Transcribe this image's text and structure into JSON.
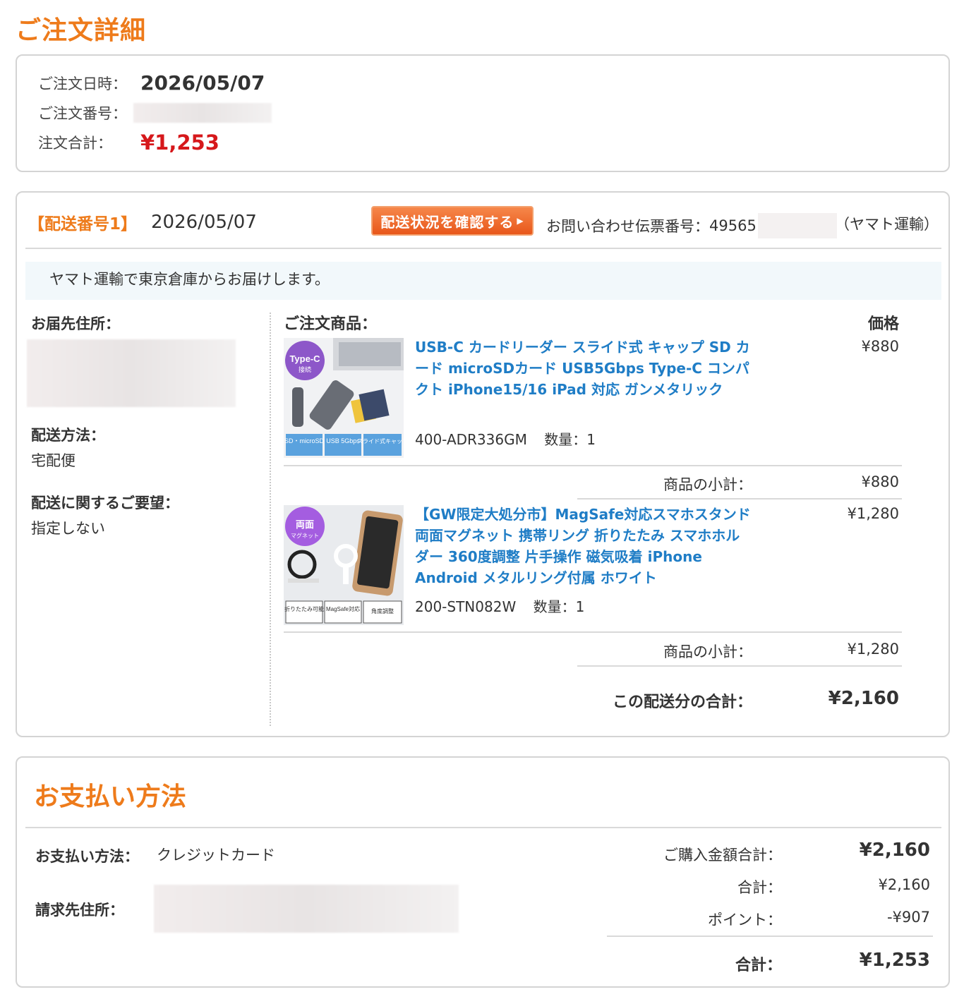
{
  "page_title": "ご注文詳細",
  "summary": {
    "date_label": "ご注文日時：",
    "date_value": "2026/05/07",
    "order_no_label": "ご注文番号：",
    "total_label": "注文合計：",
    "total_value": "¥1,253"
  },
  "shipment": {
    "number_label": "【配送番号1】",
    "date": "2026/05/07",
    "track_button": "配送状況を確認する",
    "inquiry_label": "お問い合わせ伝票番号：",
    "inquiry_number_prefix": "49565",
    "carrier": "（ヤマト運輸）",
    "notice": "ヤマト運輸で東京倉庫からお届けします。",
    "address_label": "お届先住所：",
    "method_label": "配送方法：",
    "method_value": "宅配便",
    "request_label": "配送に関するご要望：",
    "request_value": "指定しない",
    "items_header": "ご注文商品：",
    "price_header": "価格",
    "items": [
      {
        "name": "USB-C カードリーダー スライド式 キャップ SD カード microSDカード USB5Gbps Type-C コンパクト iPhone15/16 iPad 対応 ガンメタリック",
        "sku": "400-ADR336GM",
        "qty": "数量：1",
        "price": "¥880",
        "subtotal_label": "商品の小計：",
        "subtotal": "¥880",
        "thumb_badge": "Type-C",
        "thumb_badge_sub": "接続",
        "thumb_tags": [
          "SD・microSD",
          "USB 5Gbps",
          "スライド式キャップ"
        ]
      },
      {
        "name": "【GW限定大処分市】MagSafe対応スマホスタンド 両面マグネット 携帯リング 折りたたみ スマホホルダー 360度調整 片手操作 磁気吸着 iPhone Android メタルリング付属 ホワイト",
        "sku": "200-STN082W",
        "qty": "数量：1",
        "price": "¥1,280",
        "subtotal_label": "商品の小計：",
        "subtotal": "¥1,280",
        "thumb_badge": "両面",
        "thumb_badge_sub": "マグネット",
        "thumb_tags": [
          "折りたたみ可能",
          "MagSafe対応",
          "角度調整"
        ]
      }
    ],
    "shipment_total_label": "この配送分の合計：",
    "shipment_total": "¥2,160"
  },
  "payment": {
    "title": "お支払い方法",
    "method_label": "お支払い方法：",
    "method_value": "クレジットカード",
    "billing_label": "請求先住所：",
    "purchase_total_label": "ご購入金額合計：",
    "purchase_total": "¥2,160",
    "sum_label": "合計：",
    "sum_value": "¥2,160",
    "points_label": "ポイント：",
    "points_value": "-¥907",
    "grand_label": "合計：",
    "grand_value": "¥1,253"
  },
  "colors": {
    "accent": "#ee7b1b",
    "price_red": "#d6181b",
    "link_blue": "#1f7dc6"
  }
}
